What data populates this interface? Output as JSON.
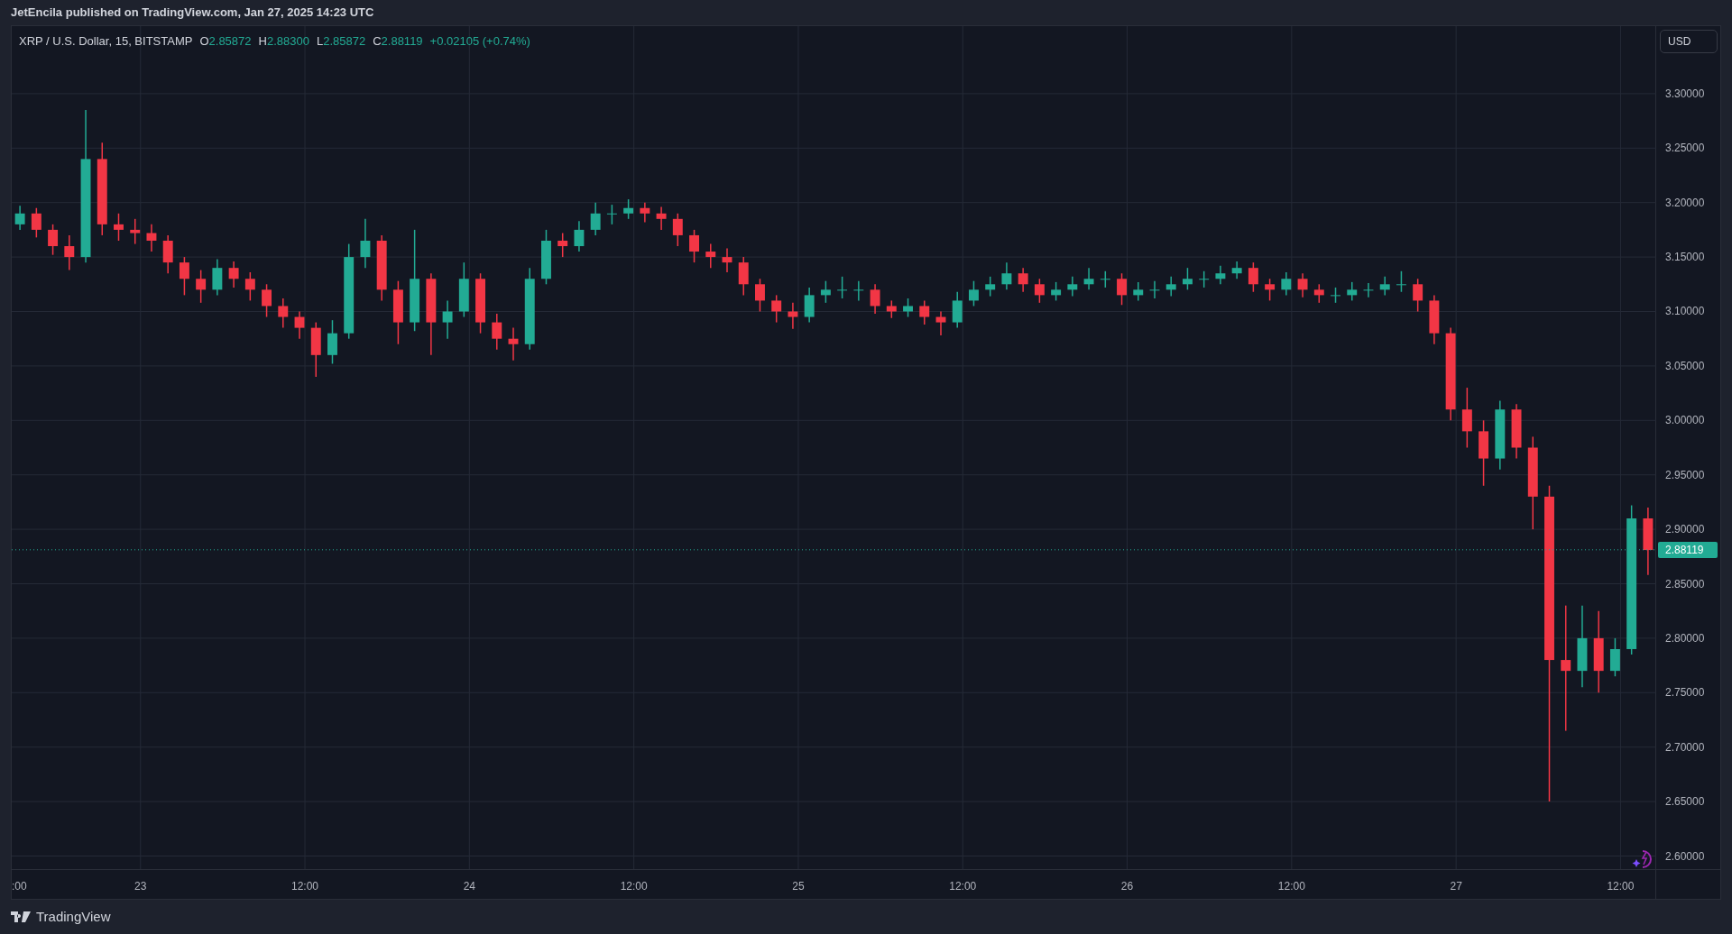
{
  "header": {
    "title": "JetEncila published on TradingView.com, Jan 27, 2025 14:23 UTC"
  },
  "legend": {
    "symbol": "XRP / U.S. Dollar, 15, BITSTAMP",
    "ohlc": [
      {
        "label": "O",
        "value": "2.85872"
      },
      {
        "label": "H",
        "value": "2.88300"
      },
      {
        "label": "L",
        "value": "2.85872"
      },
      {
        "label": "C",
        "value": "2.88119"
      }
    ],
    "change": "+0.02105 (+0.74%)"
  },
  "currency_button": "USD",
  "price_axis": {
    "last_price": "2.88119"
  },
  "chart": {
    "chart_data": {
      "type": "candlestick",
      "categories": [
        ":00",
        null,
        null,
        null,
        null,
        null,
        null,
        "23",
        null,
        null,
        null,
        null,
        null,
        null,
        null,
        null,
        null,
        "12:00",
        null,
        null,
        null,
        null,
        null,
        null,
        null,
        null,
        null,
        "24",
        null,
        null,
        null,
        null,
        null,
        null,
        null,
        null,
        null,
        "12:00",
        null,
        null,
        null,
        null,
        null,
        null,
        null,
        null,
        null,
        "25",
        null,
        null,
        null,
        null,
        null,
        null,
        null,
        null,
        null,
        "12:00",
        null,
        null,
        null,
        null,
        null,
        null,
        null,
        null,
        null,
        "26",
        null,
        null,
        null,
        null,
        null,
        null,
        null,
        null,
        null,
        "12:00",
        null,
        null,
        null,
        null,
        null,
        null,
        null,
        null,
        null,
        "27",
        null,
        null,
        null,
        null,
        null,
        null,
        null,
        null,
        null,
        "12:00",
        null,
        null
      ],
      "ohlc": [
        [
          3.18,
          3.197,
          3.175,
          3.19
        ],
        [
          3.19,
          3.195,
          3.168,
          3.175
        ],
        [
          3.175,
          3.18,
          3.152,
          3.16
        ],
        [
          3.16,
          3.17,
          3.138,
          3.15
        ],
        [
          3.15,
          3.285,
          3.145,
          3.24
        ],
        [
          3.24,
          3.255,
          3.17,
          3.18
        ],
        [
          3.18,
          3.19,
          3.165,
          3.175
        ],
        [
          3.175,
          3.185,
          3.162,
          3.172
        ],
        [
          3.172,
          3.18,
          3.155,
          3.165
        ],
        [
          3.165,
          3.17,
          3.135,
          3.145
        ],
        [
          3.145,
          3.15,
          3.115,
          3.13
        ],
        [
          3.13,
          3.138,
          3.108,
          3.12
        ],
        [
          3.12,
          3.148,
          3.115,
          3.14
        ],
        [
          3.14,
          3.146,
          3.122,
          3.13
        ],
        [
          3.13,
          3.136,
          3.11,
          3.12
        ],
        [
          3.12,
          3.125,
          3.095,
          3.105
        ],
        [
          3.105,
          3.112,
          3.085,
          3.095
        ],
        [
          3.095,
          3.1,
          3.075,
          3.085
        ],
        [
          3.085,
          3.09,
          3.04,
          3.06
        ],
        [
          3.06,
          3.092,
          3.052,
          3.08
        ],
        [
          3.08,
          3.162,
          3.075,
          3.15
        ],
        [
          3.15,
          3.185,
          3.14,
          3.165
        ],
        [
          3.165,
          3.17,
          3.11,
          3.12
        ],
        [
          3.12,
          3.128,
          3.07,
          3.09
        ],
        [
          3.09,
          3.175,
          3.082,
          3.13
        ],
        [
          3.13,
          3.135,
          3.06,
          3.09
        ],
        [
          3.09,
          3.11,
          3.075,
          3.1
        ],
        [
          3.1,
          3.145,
          3.095,
          3.13
        ],
        [
          3.13,
          3.135,
          3.08,
          3.09
        ],
        [
          3.09,
          3.098,
          3.065,
          3.075
        ],
        [
          3.075,
          3.085,
          3.055,
          3.07
        ],
        [
          3.07,
          3.14,
          3.065,
          3.13
        ],
        [
          3.13,
          3.175,
          3.125,
          3.165
        ],
        [
          3.165,
          3.172,
          3.15,
          3.16
        ],
        [
          3.16,
          3.183,
          3.155,
          3.175
        ],
        [
          3.175,
          3.2,
          3.17,
          3.19
        ],
        [
          3.19,
          3.198,
          3.18,
          3.19
        ],
        [
          3.19,
          3.203,
          3.185,
          3.195
        ],
        [
          3.195,
          3.2,
          3.182,
          3.19
        ],
        [
          3.19,
          3.196,
          3.175,
          3.185
        ],
        [
          3.185,
          3.19,
          3.16,
          3.17
        ],
        [
          3.17,
          3.175,
          3.145,
          3.155
        ],
        [
          3.155,
          3.162,
          3.14,
          3.15
        ],
        [
          3.15,
          3.158,
          3.136,
          3.145
        ],
        [
          3.145,
          3.15,
          3.115,
          3.125
        ],
        [
          3.125,
          3.13,
          3.1,
          3.11
        ],
        [
          3.11,
          3.115,
          3.09,
          3.1
        ],
        [
          3.1,
          3.108,
          3.084,
          3.095
        ],
        [
          3.095,
          3.122,
          3.09,
          3.115
        ],
        [
          3.115,
          3.128,
          3.108,
          3.12
        ],
        [
          3.12,
          3.132,
          3.112,
          3.12
        ],
        [
          3.12,
          3.128,
          3.11,
          3.12
        ],
        [
          3.12,
          3.125,
          3.098,
          3.105
        ],
        [
          3.105,
          3.11,
          3.094,
          3.1
        ],
        [
          3.1,
          3.112,
          3.095,
          3.105
        ],
        [
          3.105,
          3.11,
          3.088,
          3.095
        ],
        [
          3.095,
          3.1,
          3.078,
          3.09
        ],
        [
          3.09,
          3.118,
          3.085,
          3.11
        ],
        [
          3.11,
          3.128,
          3.105,
          3.12
        ],
        [
          3.12,
          3.132,
          3.114,
          3.125
        ],
        [
          3.125,
          3.145,
          3.12,
          3.135
        ],
        [
          3.135,
          3.14,
          3.118,
          3.125
        ],
        [
          3.125,
          3.13,
          3.108,
          3.115
        ],
        [
          3.115,
          3.127,
          3.11,
          3.12
        ],
        [
          3.12,
          3.132,
          3.114,
          3.125
        ],
        [
          3.125,
          3.14,
          3.12,
          3.13
        ],
        [
          3.13,
          3.137,
          3.122,
          3.13
        ],
        [
          3.13,
          3.135,
          3.106,
          3.115
        ],
        [
          3.115,
          3.127,
          3.11,
          3.12
        ],
        [
          3.12,
          3.128,
          3.112,
          3.12
        ],
        [
          3.12,
          3.132,
          3.114,
          3.125
        ],
        [
          3.125,
          3.14,
          3.12,
          3.13
        ],
        [
          3.13,
          3.137,
          3.122,
          3.13
        ],
        [
          3.13,
          3.142,
          3.125,
          3.135
        ],
        [
          3.135,
          3.146,
          3.13,
          3.14
        ],
        [
          3.14,
          3.145,
          3.118,
          3.125
        ],
        [
          3.125,
          3.13,
          3.11,
          3.12
        ],
        [
          3.12,
          3.136,
          3.115,
          3.13
        ],
        [
          3.13,
          3.135,
          3.113,
          3.12
        ],
        [
          3.12,
          3.125,
          3.108,
          3.115
        ],
        [
          3.115,
          3.122,
          3.108,
          3.115
        ],
        [
          3.115,
          3.127,
          3.11,
          3.12
        ],
        [
          3.12,
          3.126,
          3.113,
          3.12
        ],
        [
          3.12,
          3.132,
          3.115,
          3.125
        ],
        [
          3.125,
          3.137,
          3.118,
          3.125
        ],
        [
          3.125,
          3.13,
          3.1,
          3.11
        ],
        [
          3.11,
          3.115,
          3.07,
          3.08
        ],
        [
          3.08,
          3.085,
          3.0,
          3.01
        ],
        [
          3.01,
          3.03,
          2.975,
          2.99
        ],
        [
          2.99,
          3.0,
          2.94,
          2.965
        ],
        [
          2.965,
          3.018,
          2.955,
          3.01
        ],
        [
          3.01,
          3.015,
          2.965,
          2.975
        ],
        [
          2.975,
          2.985,
          2.9,
          2.93
        ],
        [
          2.93,
          2.94,
          2.65,
          2.78
        ],
        [
          2.78,
          2.83,
          2.715,
          2.77
        ],
        [
          2.77,
          2.83,
          2.755,
          2.8
        ],
        [
          2.8,
          2.825,
          2.75,
          2.77
        ],
        [
          2.77,
          2.8,
          2.765,
          2.79
        ],
        [
          2.79,
          2.922,
          2.785,
          2.91
        ],
        [
          2.91,
          2.92,
          2.858,
          2.881
        ]
      ],
      "ylim": [
        2.588,
        3.362
      ],
      "grid": true,
      "ref_lines": [
        {
          "axis": "y",
          "value": 2.88119,
          "color": "#22ab94"
        }
      ],
      "yticks": [
        {
          "value": 3.3,
          "label": "3.30000"
        },
        {
          "value": 3.25,
          "label": "3.25000"
        },
        {
          "value": 3.2,
          "label": "3.20000"
        },
        {
          "value": 3.15,
          "label": "3.15000"
        },
        {
          "value": 3.1,
          "label": "3.10000"
        },
        {
          "value": 3.05,
          "label": "3.05000"
        },
        {
          "value": 3.0,
          "label": "3.00000"
        },
        {
          "value": 2.95,
          "label": "2.95000"
        },
        {
          "value": 2.9,
          "label": "2.90000"
        },
        {
          "value": 2.85,
          "label": "2.85000"
        },
        {
          "value": 2.8,
          "label": "2.80000"
        },
        {
          "value": 2.75,
          "label": "2.75000"
        },
        {
          "value": 2.7,
          "label": "2.70000"
        },
        {
          "value": 2.65,
          "label": "2.65000"
        },
        {
          "value": 2.6,
          "label": "2.60000"
        }
      ]
    }
  },
  "footer": {
    "brand": "TradingView"
  }
}
